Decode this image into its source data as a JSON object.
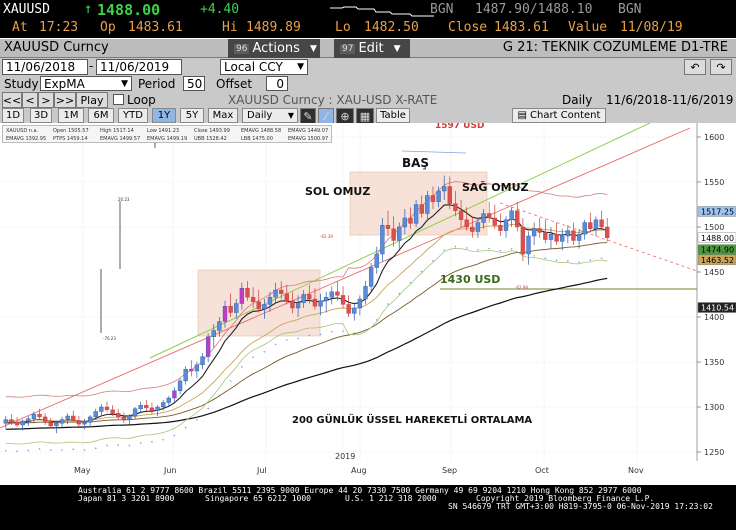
{
  "ticker": {
    "symbol": "XAUUSD",
    "arrow": "↑",
    "last": "1488.00",
    "change": "+4.40",
    "bgn_label": "BGN",
    "bid_ask": "1487.90/1488.10",
    "bgn2": "BGN",
    "at_label": "At",
    "time": "17:23",
    "op_label": "Op",
    "open": "1483.61",
    "hi_label": "Hi",
    "high": "1489.89",
    "lo_label": "Lo",
    "low": "1482.50",
    "close_label": "Close",
    "close": "1483.61",
    "value_label": "Value",
    "value_date": "11/08/19"
  },
  "header": {
    "title": "XAUUSD  Curncy",
    "actions_num": "96",
    "actions_label": "Actions",
    "edit_num": "97",
    "edit_label": "Edit",
    "right_title": "G 21: TEKNIK COZUMLEME D1-TRE"
  },
  "controls": {
    "date_from": "11/06/2018",
    "date_to": "11/06/2019",
    "currency": "Local CCY",
    "study_label": "Study",
    "study_value": "ExpMA",
    "period_label": "Period",
    "period_value": "50",
    "offset_label": "Offset",
    "offset_value": "0",
    "play_label": "Play",
    "loop_label": "Loop",
    "instrument": "XAUUSD  Curncy : XAU-USD X-RATE",
    "freq": "Daily",
    "range": "11/6/2018-11/6/2019",
    "ranges": [
      "1D",
      "3D",
      "1M",
      "6M",
      "YTD",
      "1Y",
      "5Y",
      "Max"
    ],
    "selected_range": "1Y",
    "period_select": "Daily",
    "table_label": "Table",
    "chart_content_label": "Chart Content"
  },
  "legend": {
    "items": [
      "XAUUSD n.a.",
      "Open 1505.57",
      "High 1517.14",
      "Low 1491.23",
      "Close 1493.99",
      "EMAVG 1488.58",
      "EMAVG 1449.07",
      "EMAVG 1392.95",
      "PTPS 1459.14",
      "EMAVG 1499.57",
      "EMAVG 1499.19",
      "UBB 1528.42",
      "LBB 1475.00",
      "EMAVG 1500.97"
    ]
  },
  "chart_data": {
    "type": "candlestick",
    "x": [
      "May",
      "Jun",
      "Jul",
      "2019",
      "Aug",
      "Sep",
      "Oct",
      "Nov"
    ],
    "ylim": [
      1240,
      1610
    ],
    "yticks": [
      1250,
      1300,
      1350,
      1400,
      1450,
      1500,
      1550,
      1600
    ],
    "price_labels": [
      {
        "value": "1517.25",
        "color": "#9ec3f0"
      },
      {
        "value": "1488.00",
        "color": "#ffffff"
      },
      {
        "value": "1474.90",
        "color": "#4a9a3a"
      },
      {
        "value": "1463.52",
        "color": "#c9a45a"
      },
      {
        "value": "1410.54",
        "color": "#222222"
      }
    ],
    "annotations": [
      "BAŞ",
      "SOL OMUZ",
      "SAĞ OMUZ",
      "1430 USD",
      "200 GÜNLÜK ÜSSEL HAREKETLİ ORTALAMA",
      "1597 USD"
    ],
    "small_labels": [
      "20.23",
      "-70.23",
      "-62.39",
      "-62.98"
    ],
    "ohlc": [
      [
        1282,
        1290,
        1276,
        1286
      ],
      [
        1286,
        1292,
        1280,
        1283
      ],
      [
        1283,
        1289,
        1278,
        1280
      ],
      [
        1280,
        1286,
        1274,
        1284
      ],
      [
        1284,
        1290,
        1279,
        1287
      ],
      [
        1287,
        1295,
        1282,
        1292
      ],
      [
        1292,
        1298,
        1286,
        1289
      ],
      [
        1289,
        1293,
        1280,
        1283
      ],
      [
        1283,
        1288,
        1276,
        1279
      ],
      [
        1279,
        1285,
        1271,
        1282
      ],
      [
        1282,
        1289,
        1277,
        1286
      ],
      [
        1286,
        1293,
        1281,
        1290
      ],
      [
        1290,
        1296,
        1284,
        1285
      ],
      [
        1285,
        1290,
        1278,
        1281
      ],
      [
        1281,
        1287,
        1275,
        1283
      ],
      [
        1283,
        1291,
        1279,
        1289
      ],
      [
        1289,
        1298,
        1286,
        1295
      ],
      [
        1295,
        1303,
        1291,
        1300
      ],
      [
        1300,
        1306,
        1294,
        1297
      ],
      [
        1297,
        1302,
        1290,
        1293
      ],
      [
        1293,
        1298,
        1286,
        1289
      ],
      [
        1289,
        1294,
        1282,
        1286
      ],
      [
        1286,
        1292,
        1280,
        1290
      ],
      [
        1290,
        1300,
        1287,
        1298
      ],
      [
        1298,
        1306,
        1293,
        1302
      ],
      [
        1302,
        1308,
        1296,
        1299
      ],
      [
        1299,
        1305,
        1292,
        1296
      ],
      [
        1296,
        1302,
        1290,
        1300
      ],
      [
        1300,
        1308,
        1296,
        1305
      ],
      [
        1305,
        1312,
        1300,
        1310
      ],
      [
        1310,
        1322,
        1306,
        1318
      ],
      [
        1318,
        1332,
        1314,
        1329
      ],
      [
        1329,
        1345,
        1325,
        1342
      ],
      [
        1342,
        1352,
        1334,
        1340
      ],
      [
        1340,
        1350,
        1332,
        1347
      ],
      [
        1347,
        1360,
        1342,
        1356
      ],
      [
        1356,
        1382,
        1350,
        1378
      ],
      [
        1378,
        1392,
        1366,
        1385
      ],
      [
        1385,
        1400,
        1378,
        1395
      ],
      [
        1395,
        1418,
        1388,
        1412
      ],
      [
        1412,
        1426,
        1400,
        1405
      ],
      [
        1405,
        1420,
        1398,
        1415
      ],
      [
        1415,
        1438,
        1408,
        1432
      ],
      [
        1432,
        1440,
        1418,
        1422
      ],
      [
        1422,
        1433,
        1410,
        1417
      ],
      [
        1417,
        1430,
        1405,
        1409
      ],
      [
        1409,
        1420,
        1398,
        1414
      ],
      [
        1414,
        1428,
        1406,
        1422
      ],
      [
        1422,
        1438,
        1415,
        1430
      ],
      [
        1430,
        1440,
        1420,
        1426
      ],
      [
        1426,
        1436,
        1414,
        1418
      ],
      [
        1418,
        1428,
        1404,
        1410
      ],
      [
        1410,
        1424,
        1400,
        1416
      ],
      [
        1416,
        1430,
        1410,
        1425
      ],
      [
        1425,
        1436,
        1415,
        1420
      ],
      [
        1420,
        1432,
        1408,
        1412
      ],
      [
        1412,
        1426,
        1402,
        1418
      ],
      [
        1418,
        1428,
        1405,
        1422
      ],
      [
        1422,
        1434,
        1414,
        1428
      ],
      [
        1428,
        1440,
        1418,
        1424
      ],
      [
        1424,
        1434,
        1410,
        1414
      ],
      [
        1414,
        1424,
        1400,
        1404
      ],
      [
        1404,
        1416,
        1396,
        1410
      ],
      [
        1410,
        1424,
        1402,
        1420
      ],
      [
        1420,
        1440,
        1414,
        1434
      ],
      [
        1434,
        1460,
        1428,
        1455
      ],
      [
        1455,
        1478,
        1448,
        1470
      ],
      [
        1470,
        1510,
        1462,
        1502
      ],
      [
        1502,
        1518,
        1490,
        1498
      ],
      [
        1498,
        1512,
        1478,
        1485
      ],
      [
        1485,
        1505,
        1476,
        1500
      ],
      [
        1500,
        1520,
        1492,
        1510
      ],
      [
        1510,
        1522,
        1498,
        1504
      ],
      [
        1504,
        1530,
        1500,
        1525
      ],
      [
        1525,
        1535,
        1510,
        1515
      ],
      [
        1515,
        1540,
        1508,
        1535
      ],
      [
        1535,
        1545,
        1520,
        1528
      ],
      [
        1528,
        1545,
        1522,
        1540
      ],
      [
        1540,
        1557,
        1530,
        1545
      ],
      [
        1545,
        1556,
        1520,
        1526
      ],
      [
        1526,
        1540,
        1512,
        1518
      ],
      [
        1518,
        1530,
        1500,
        1508
      ],
      [
        1508,
        1522,
        1496,
        1500
      ],
      [
        1500,
        1512,
        1488,
        1495
      ],
      [
        1495,
        1510,
        1488,
        1505
      ],
      [
        1505,
        1520,
        1498,
        1515
      ],
      [
        1515,
        1528,
        1505,
        1510
      ],
      [
        1510,
        1525,
        1498,
        1502
      ],
      [
        1502,
        1515,
        1490,
        1496
      ],
      [
        1496,
        1512,
        1488,
        1508
      ],
      [
        1508,
        1522,
        1500,
        1518
      ],
      [
        1518,
        1528,
        1495,
        1500
      ],
      [
        1500,
        1510,
        1462,
        1470
      ],
      [
        1470,
        1495,
        1458,
        1490
      ],
      [
        1490,
        1505,
        1480,
        1498
      ],
      [
        1498,
        1510,
        1488,
        1494
      ],
      [
        1494,
        1508,
        1482,
        1486
      ],
      [
        1486,
        1500,
        1476,
        1492
      ],
      [
        1492,
        1505,
        1480,
        1484
      ],
      [
        1484,
        1498,
        1474,
        1490
      ],
      [
        1490,
        1502,
        1482,
        1496
      ],
      [
        1496,
        1505,
        1480,
        1485
      ],
      [
        1485,
        1498,
        1476,
        1492
      ],
      [
        1492,
        1508,
        1486,
        1505
      ],
      [
        1505,
        1516,
        1494,
        1498
      ],
      [
        1498,
        1512,
        1490,
        1508
      ],
      [
        1508,
        1518,
        1496,
        1500
      ],
      [
        1500,
        1510,
        1484,
        1488
      ]
    ]
  },
  "footer": {
    "line1": "Australia 61 2 9777 8600 Brazil 5511 2395 9000 Europe 44 20 7330 7500 Germany 49 69 9204 1210 Hong Kong 852 2977 6000",
    "line2a": "Japan 81 3 3201 8900",
    "line2b": "Singapore 65 6212 1000",
    "line2c": "U.S. 1 212 318 2000",
    "line2d": "Copyright 2019 Bloomberg Finance L.P.",
    "line3": "SN 546679 TRT  GMT+3:00 H819-3795-0 06-Nov-2019 17:23:02"
  }
}
